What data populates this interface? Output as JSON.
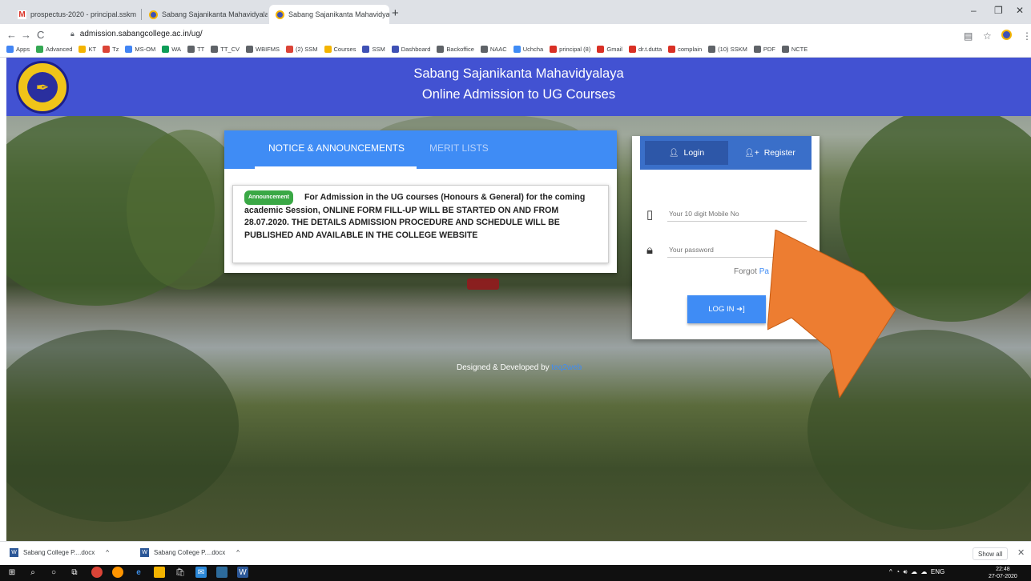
{
  "browser": {
    "tabs": [
      {
        "title": "prospectus-2020 - principal.sskm",
        "favicon": "gmail-icon",
        "active": false
      },
      {
        "title": "Sabang Sajanikanta Mahavidyala",
        "favicon": "chrome-page-icon",
        "active": false
      },
      {
        "title": "Sabang Sajanikanta Mahavidyala",
        "favicon": "chrome-page-icon",
        "active": true
      }
    ],
    "new_tab": "+",
    "window_controls": {
      "minimize": "–",
      "maximize": "❐",
      "close": "✕"
    },
    "address": "admission.sabangcollege.ac.in/ug/",
    "bookmarks": [
      "Apps",
      "Advanced",
      "KT",
      "Tz",
      "MS-OM",
      "WA",
      "TT",
      "TT_CV",
      "WBIFMS",
      "(2) SSM",
      "Courses",
      "SSM",
      "Dashboard",
      "Backoffice",
      "NAAC",
      "Uchcha",
      "principal (8)",
      "Gmail",
      "dr.t.dutta",
      "complain",
      "(10) SSKM",
      "PDF",
      "NCTE"
    ]
  },
  "header": {
    "college": "Sabang Sajanikanta Mahavidyalaya",
    "subtitle": "Online Admission to UG Courses"
  },
  "notice": {
    "tabs": [
      "NOTICE & ANNOUNCEMENTS",
      "MERIT LISTS"
    ],
    "badge": "Announcement",
    "text": "For Admission in the UG courses (Honours & General) for the coming academic Session, ONLINE FORM FILL-UP WILL BE STARTED ON AND FROM 28.07.2020. THE DETAILS ADMISSION PROCEDURE AND SCHEDULE WILL BE PUBLISHED AND AVAILABLE IN THE COLLEGE WEBSITE"
  },
  "login": {
    "tab_login": "Login",
    "tab_register": "Register",
    "mobile_placeholder": "Your 10 digit Mobile No",
    "password_placeholder": "Your password",
    "forgot_prefix": "Forgot ",
    "forgot_link": "Pa",
    "button": "LOG IN"
  },
  "credit": {
    "prefix": "Designed & Developed by ",
    "link": "teq2web"
  },
  "downloads": {
    "items": [
      "Sabang College P....docx",
      "Sabang College P....docx"
    ],
    "show_all": "Show all",
    "close": "✕"
  },
  "taskbar": {
    "tray": "ENG",
    "time": "22:48",
    "date": "27-07-2020"
  },
  "colors": {
    "header": "#4252d2",
    "accent": "#3f8cf5",
    "arrow": "#ed7d31"
  }
}
